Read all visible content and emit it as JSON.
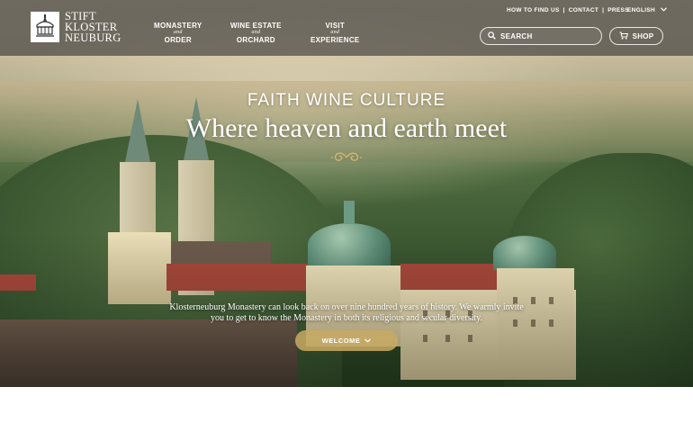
{
  "brand": {
    "line1": "STIFT",
    "line2": "KLOSTER",
    "line3": "NEUBURG"
  },
  "nav": [
    {
      "line1": "MONASTERY",
      "and": "and",
      "line2": "ORDER"
    },
    {
      "line1": "WINE ESTATE",
      "and": "and",
      "line2": "ORCHARD"
    },
    {
      "line1": "VISIT",
      "and": "and",
      "line2": "EXPERIENCE"
    }
  ],
  "toplinks": {
    "how_to_find_us": "HOW TO FIND US",
    "contact": "CONTACT",
    "press": "PRESS",
    "separator": "|"
  },
  "language": {
    "selected": "ENGLISH",
    "icon": "chevron-down-icon"
  },
  "search": {
    "placeholder": "SEARCH",
    "icon": "search-icon"
  },
  "shop": {
    "label": "SHOP",
    "icon": "cart-icon"
  },
  "hero": {
    "kicker": "FAITH WINE CULTURE",
    "headline": "Where heaven and earth meet",
    "intro_line1": "Klosterneuburg Monastery can look back on over nine hundred years of history. We warmly invite",
    "intro_line2": "you to get to know the Monastery in both its religious and secular diversity.",
    "cta_label": "WELCOME",
    "cta_icon": "chevron-down-icon"
  },
  "colors": {
    "header_bg": "#343434",
    "accent_gold": "#c8aa64",
    "white": "#ffffff"
  }
}
